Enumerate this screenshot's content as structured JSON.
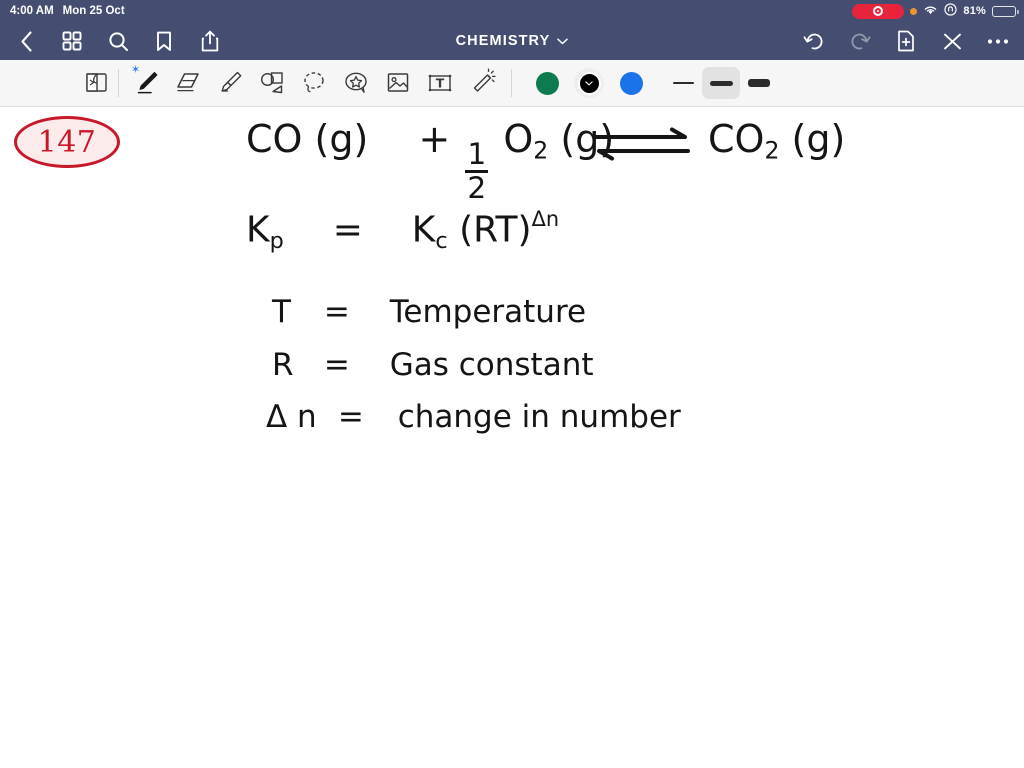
{
  "status_bar": {
    "time": "4:00 AM",
    "date": "Mon 25 Oct",
    "battery_pct": "81%",
    "battery_level": 81,
    "icons": [
      "screen-record-icon",
      "orange-dot-icon",
      "wifi-icon",
      "control-center-icon",
      "battery-icon"
    ]
  },
  "nav_bar": {
    "title": "CHEMISTRY",
    "title_chevron": "chevron-down-icon",
    "bg_color": "#454e70",
    "left_items": [
      {
        "name": "back-button",
        "icon": "chevron-left-icon"
      },
      {
        "name": "thumbnails-button",
        "icon": "grid-icon"
      },
      {
        "name": "search-button",
        "icon": "search-icon"
      },
      {
        "name": "bookmark-button",
        "icon": "bookmark-icon"
      },
      {
        "name": "share-button",
        "icon": "share-icon"
      }
    ],
    "right_items": [
      {
        "name": "undo-button",
        "icon": "undo-icon",
        "enabled": true
      },
      {
        "name": "redo-button",
        "icon": "redo-icon",
        "enabled": false
      },
      {
        "name": "add-page-button",
        "icon": "document-plus-icon",
        "enabled": true
      },
      {
        "name": "close-button",
        "icon": "close-icon",
        "enabled": true
      },
      {
        "name": "more-button",
        "icon": "ellipsis-icon",
        "enabled": true
      }
    ]
  },
  "tool_bar": {
    "bg_color": "#f6f6f6",
    "tools": [
      {
        "name": "page-flip-tool",
        "icon": "page-flip-icon",
        "selected": false
      },
      {
        "name": "pen-tool",
        "icon": "pen-icon",
        "selected": true,
        "badge": "bluetooth-icon"
      },
      {
        "name": "eraser-tool",
        "icon": "eraser-icon",
        "selected": false
      },
      {
        "name": "highlighter-tool",
        "icon": "highlighter-icon",
        "selected": false
      },
      {
        "name": "shapes-tool",
        "icon": "shapes-icon",
        "selected": false
      },
      {
        "name": "lasso-tool",
        "icon": "lasso-icon",
        "selected": false
      },
      {
        "name": "sticker-tool",
        "icon": "sticker-star-icon",
        "selected": false
      },
      {
        "name": "image-tool",
        "icon": "image-icon",
        "selected": false
      },
      {
        "name": "text-box-tool",
        "icon": "text-box-icon",
        "selected": false
      },
      {
        "name": "magic-wand-tool",
        "icon": "magic-wand-icon",
        "selected": false
      }
    ],
    "colors": [
      {
        "name": "color-swatch-green",
        "hex": "#0d7a4f",
        "selected": false
      },
      {
        "name": "color-swatch-black",
        "hex": "#000000",
        "selected": true
      },
      {
        "name": "color-swatch-blue",
        "hex": "#1a73e8",
        "selected": false
      }
    ],
    "stroke_widths": [
      {
        "name": "stroke-width-thin",
        "label": "thin",
        "px": 2,
        "selected": false
      },
      {
        "name": "stroke-width-medium",
        "label": "medium",
        "px": 5,
        "selected": true
      },
      {
        "name": "stroke-width-thick",
        "label": "thick",
        "px": 8,
        "selected": false
      }
    ]
  },
  "canvas": {
    "page_number": "147",
    "notes": {
      "equation": {
        "left_reactant": "CO (g)",
        "plus": "+",
        "coefficient_numerator": "1",
        "coefficient_denominator": "2",
        "second_reactant_formula": "O",
        "second_reactant_subscript": "2",
        "second_reactant_state": "(g)",
        "arrow": "equilibrium-arrow",
        "product_formula": "CO",
        "product_subscript": "2",
        "product_state": "(g)"
      },
      "formula": {
        "lhs": "K",
        "lhs_sub": "p",
        "equals": "=",
        "rhs": "K",
        "rhs_sub": "c",
        "rhs_term": "(RT)",
        "exponent": "Δn"
      },
      "definitions": [
        {
          "symbol": "T",
          "equals": "=",
          "meaning": "Temperature"
        },
        {
          "symbol": "R",
          "equals": "=",
          "meaning": "Gas  constant"
        },
        {
          "symbol": "Δ n",
          "equals": "=",
          "meaning": "change in number"
        }
      ]
    }
  }
}
